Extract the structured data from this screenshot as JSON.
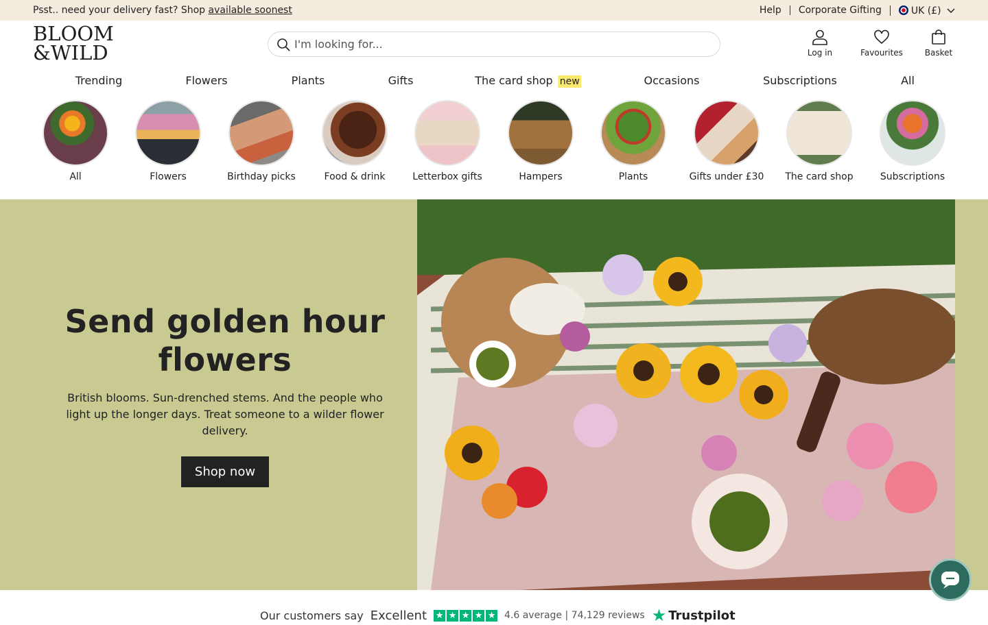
{
  "top_banner": {
    "message": "Psst.. need your delivery fast? Shop ",
    "link": "available soonest",
    "help": "Help",
    "corporate": "Corporate Gifting",
    "currency": "UK (£)"
  },
  "logo": {
    "line1": "BLOOM",
    "line2": "&WILD"
  },
  "search": {
    "placeholder": "I'm looking for..."
  },
  "header_icons": {
    "login": "Log in",
    "favourites": "Favourites",
    "basket": "Basket"
  },
  "nav": {
    "items": [
      "Trending",
      "Flowers",
      "Plants",
      "Gifts",
      "The card shop",
      "Occasions",
      "Subscriptions",
      "All"
    ],
    "new_badge": "new"
  },
  "categories": [
    "All",
    "Flowers",
    "Birthday picks",
    "Food & drink",
    "Letterbox gifts",
    "Hampers",
    "Plants",
    "Gifts under £30",
    "The card shop",
    "Subscriptions"
  ],
  "hero": {
    "title": "Send golden hour flowers",
    "body": "British blooms. Sun-drenched stems. And the people who light up the longer days. Treat someone to a wilder flower delivery.",
    "cta": "Shop now",
    "bg_color": "#c8ca91"
  },
  "trust": {
    "intro": "Our customers say",
    "rating_word": "Excellent",
    "average": "4.6 average | 74,129 reviews",
    "brand": "Trustpilot"
  },
  "colors": {
    "banner": "#f5ece0",
    "cta": "#222222",
    "new_badge": "#fbe96f",
    "trustpilot_green": "#00b67a",
    "chat": "#2e6b5f"
  }
}
